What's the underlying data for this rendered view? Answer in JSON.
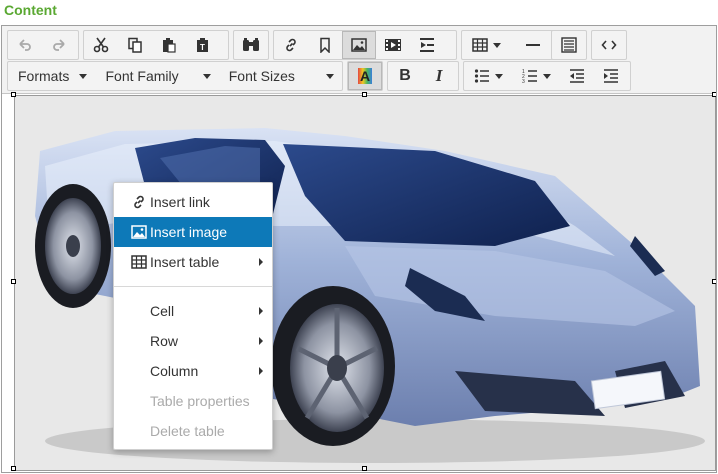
{
  "label": "Content",
  "colors": {
    "label": "#5aa832",
    "highlight": "#0d79b8"
  },
  "toolbar": {
    "icons": {
      "undo": "undo-icon",
      "redo": "redo-icon",
      "cut": "cut-icon",
      "copy": "copy-icon",
      "paste": "paste-icon",
      "paste_text": "paste-as-text-icon",
      "find": "find-replace-icon",
      "link": "link-icon",
      "anchor": "bookmark-icon",
      "image": "image-icon",
      "media": "media-icon",
      "indent_page": "page-break-icon",
      "table": "table-icon",
      "hr": "horizontal-rule-icon",
      "code_sample": "code-block-icon",
      "source": "source-code-icon"
    },
    "formats": "Formats",
    "font_family": "Font Family",
    "font_sizes": "Font Sizes",
    "text_color_letter": "A",
    "bold": "B",
    "italic": "I"
  },
  "context_menu": {
    "items": [
      {
        "label": "Insert link",
        "icon": "link-icon"
      },
      {
        "label": "Insert image",
        "icon": "image-icon"
      },
      {
        "label": "Insert table",
        "icon": "table-icon"
      },
      {
        "label": "Cell"
      },
      {
        "label": "Row"
      },
      {
        "label": "Column"
      },
      {
        "label": "Table properties"
      },
      {
        "label": "Delete table"
      }
    ]
  },
  "image": {
    "subject": "silver-blue sports car"
  }
}
